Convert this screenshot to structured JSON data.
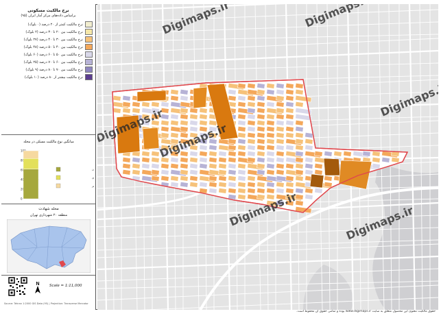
{
  "legend": {
    "title": "نرخ مالکیت مسکونی",
    "subtitle": "براساس داده‌های مرکز آمار ایران (۹۵)",
    "items": [
      {
        "label": "نرخ مالکیت کمتر از ۲۰ درصد (۰ بلوک)",
        "color": "#f2eecf"
      },
      {
        "label": "نرخ مالکیت بین ۲۰ تا ۳۰ درصد (۲ بلوک)",
        "color": "#f5e7a8"
      },
      {
        "label": "نرخ مالکیت بین ۳۰ تا ۴۰ درصد (۲۷ بلوک)",
        "color": "#f6c27a"
      },
      {
        "label": "نرخ مالکیت بین ۴۰ تا ۵۰ درصد (۴۸ بلوک)",
        "color": "#f4a85b"
      },
      {
        "label": "نرخ مالکیت بین ۵۰ تا ۶۰ درصد (۶۰ بلوک)",
        "color": "#d9d8ea"
      },
      {
        "label": "نرخ مالکیت بین ۶۰ تا ۷۰ درصد (۲۵ بلوک)",
        "color": "#b7b3d6"
      },
      {
        "label": "نرخ مالکیت بین ۷۰ تا ۸۰ درصد (۹ بلوک)",
        "color": "#8e86bf"
      },
      {
        "label": "نرخ مالکیت بیشتر از ۸۰ درصد (۱۰ بلوک)",
        "color": "#5b3d8f"
      }
    ]
  },
  "chart_data": {
    "type": "bar",
    "title": "میانگین نوع مالکیت مسکن در محله",
    "yticks": [
      "100",
      "80",
      "60",
      "40",
      "20",
      "0"
    ],
    "ylim": [
      0,
      100
    ],
    "stacked": [
      {
        "name": "ملکی عرصه و اعیان",
        "value": 62,
        "color": "#a6a83d"
      },
      {
        "name": "رهن استیجاری",
        "value": 22,
        "color": "#e3e05a"
      },
      {
        "name": "سایر",
        "value": 16,
        "color": "#f6d9a0"
      }
    ]
  },
  "locator": {
    "title": "محله شهادت",
    "subtitle": "منطقه ۲۰ شهرداری تهران"
  },
  "scale": "Scale = 1:11,000",
  "credit_small": "Source: Tehran 1:2000 GIS Data (95) | Projection: Transverse Mercator",
  "watermark": "Digimaps.ir",
  "footer": "حقوق مالکیت معنوی این محصول متعلق به سایت www.digimaps.ir بوده و تمامی حقوق آن محفوظ است.",
  "colors": {
    "boundary": "#e0484d",
    "background": "#e6e6e6",
    "road": "#ffffff"
  }
}
